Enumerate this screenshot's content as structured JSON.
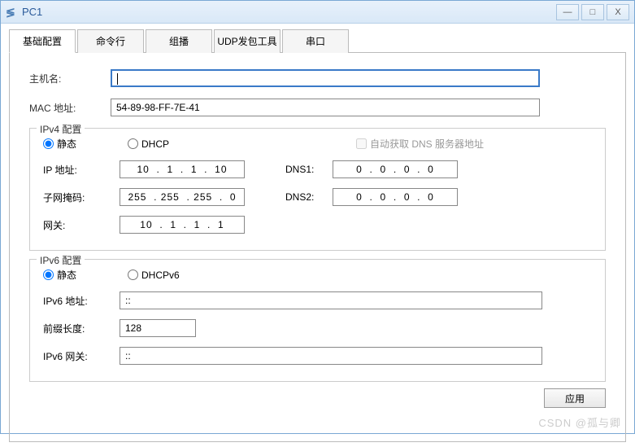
{
  "window": {
    "title": "PC1"
  },
  "tabs": [
    "基础配置",
    "命令行",
    "组播",
    "UDP发包工具",
    "串口"
  ],
  "basic": {
    "hostname_label": "主机名:",
    "hostname_value": "",
    "mac_label": "MAC 地址:",
    "mac_value": "54-89-98-FF-7E-41"
  },
  "ipv4": {
    "legend": "IPv4 配置",
    "static_label": "静态",
    "dhcp_label": "DHCP",
    "auto_dns_label": "自动获取 DNS 服务器地址",
    "ip_label": "IP 地址:",
    "ip_value": "10  .  1  .  1  .  10",
    "mask_label": "子网掩码:",
    "mask_value": "255  . 255  . 255  .  0",
    "gateway_label": "网关:",
    "gateway_value": "10  .  1  .  1  .  1",
    "dns1_label": "DNS1:",
    "dns1_value": "0  .  0  .  0  .  0",
    "dns2_label": "DNS2:",
    "dns2_value": "0  .  0  .  0  .  0"
  },
  "ipv6": {
    "legend": "IPv6 配置",
    "static_label": "静态",
    "dhcp_label": "DHCPv6",
    "addr_label": "IPv6 地址:",
    "addr_value": "::",
    "prefix_label": "前缀长度:",
    "prefix_value": "128",
    "gateway_label": "IPv6 网关:",
    "gateway_value": "::"
  },
  "apply_label": "应用",
  "watermark": "CSDN @孤与卿"
}
